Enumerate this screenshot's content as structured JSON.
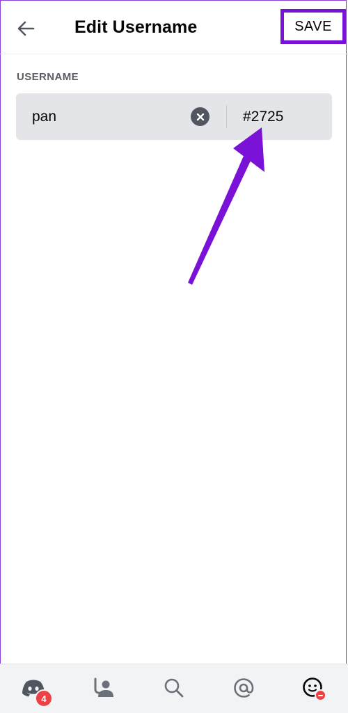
{
  "header": {
    "back_icon": "arrow-left-icon",
    "title": "Edit Username",
    "save_label": "SAVE",
    "save_highlight_color": "#7a11d6"
  },
  "username_section": {
    "label": "USERNAME",
    "value": "pan",
    "clear_icon": "clear-circle-icon",
    "discriminator": "#2725"
  },
  "annotation": {
    "type": "arrow",
    "color": "#7a11d6",
    "points_to": "discriminator"
  },
  "bottom_nav": {
    "items": [
      {
        "icon": "discord-home-icon",
        "badge": "4"
      },
      {
        "icon": "friends-icon"
      },
      {
        "icon": "search-icon"
      },
      {
        "icon": "mentions-icon"
      },
      {
        "icon": "profile-avatar-icon",
        "status": "do-not-disturb"
      }
    ],
    "badge_color": "#ed4245"
  }
}
